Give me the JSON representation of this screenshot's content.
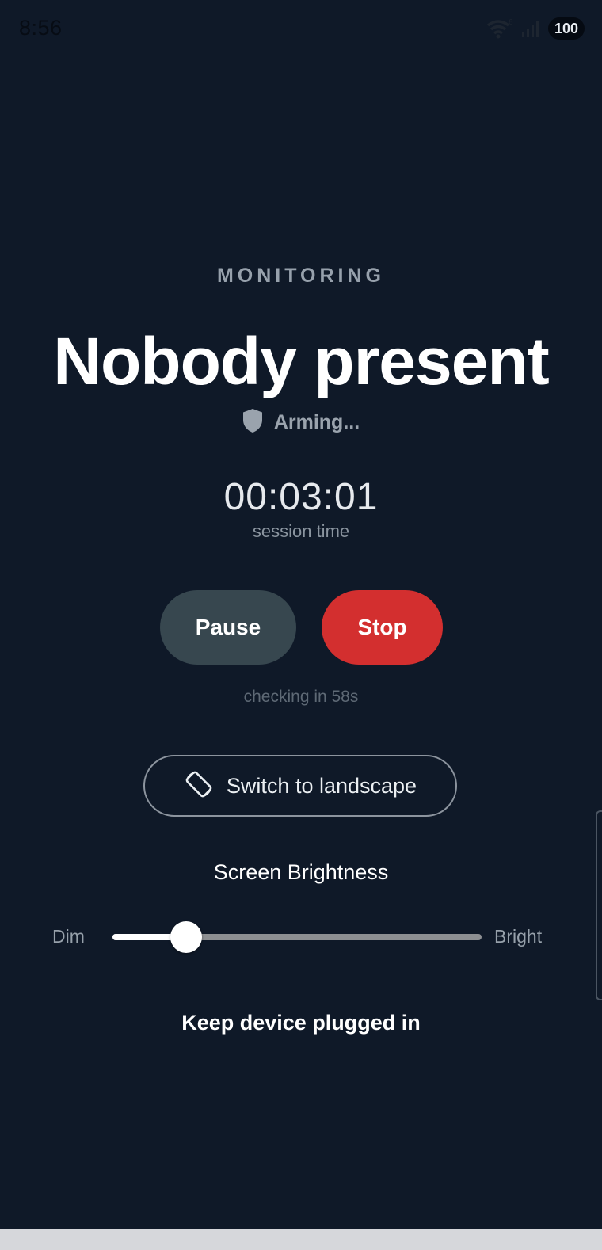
{
  "status_bar": {
    "time": "8:56",
    "wifi_badge": "6",
    "battery": "100"
  },
  "monitor": {
    "mode_label": "MONITORING",
    "headline": "Nobody present",
    "arming_text": "Arming...",
    "session_time": "00:03:01",
    "session_caption": "session time",
    "checking_text": "checking in 58s"
  },
  "controls": {
    "pause_label": "Pause",
    "stop_label": "Stop",
    "landscape_label": "Switch to landscape"
  },
  "brightness": {
    "title": "Screen Brightness",
    "min_label": "Dim",
    "max_label": "Bright",
    "value": 0.2
  },
  "footer_note": "Keep device plugged in",
  "colors": {
    "background": "#0f1928",
    "pause_button": "#37474f",
    "stop_button": "#d32f2f"
  },
  "icons": {
    "status_wifi": "wifi-icon",
    "status_signal": "signal-icon",
    "arming": "shield-icon",
    "landscape": "screen-rotation-icon"
  }
}
